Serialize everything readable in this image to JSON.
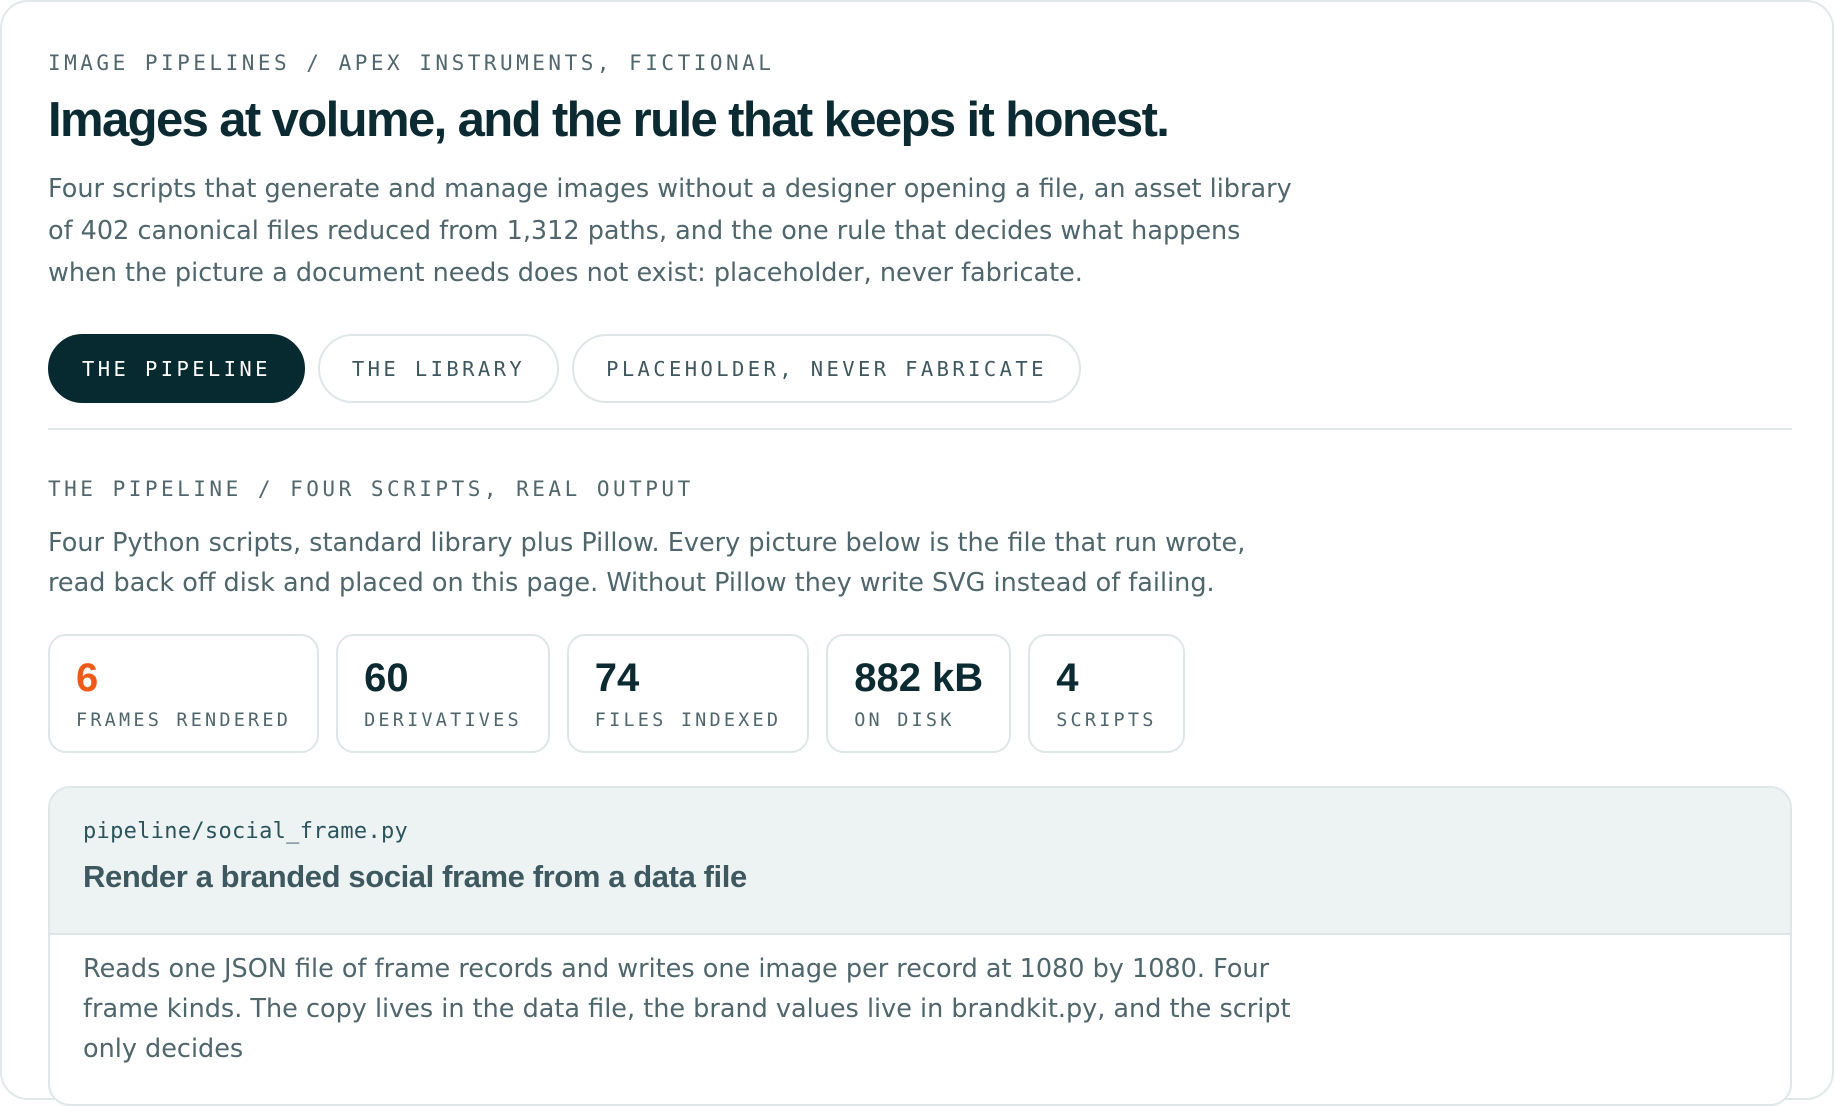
{
  "header": {
    "eyebrow": "IMAGE PIPELINES / APEX INSTRUMENTS, FICTIONAL",
    "title": "Images at volume, and the rule that keeps it honest.",
    "lede": "Four scripts that generate and manage images without a designer opening a file, an asset library of 402 canonical files reduced from 1,312 paths, and the one rule that decides what happens when the picture a document needs does not exist: placeholder, never fabricate."
  },
  "tabs": [
    {
      "label": "THE PIPELINE",
      "active": true
    },
    {
      "label": "THE LIBRARY",
      "active": false
    },
    {
      "label": "PLACEHOLDER, NEVER FABRICATE",
      "active": false
    }
  ],
  "section": {
    "eyebrow": "THE PIPELINE / FOUR SCRIPTS, REAL OUTPUT",
    "description": "Four Python scripts, standard library plus Pillow. Every picture below is the file that run wrote, read back off disk and placed on this page. Without Pillow they write SVG instead of failing."
  },
  "stats": [
    {
      "value": "6",
      "label": "FRAMES RENDERED"
    },
    {
      "value": "60",
      "label": "DERIVATIVES"
    },
    {
      "value": "74",
      "label": "FILES INDEXED"
    },
    {
      "value": "882 kB",
      "label": "ON DISK"
    },
    {
      "value": "4",
      "label": "SCRIPTS"
    }
  ],
  "card": {
    "path": "pipeline/social_frame.py",
    "title": "Render a branded social frame from a data file",
    "body": "Reads one JSON file of frame records and writes one image per record at 1080 by 1080. Four frame kinds. The copy lives in the data file, the brand values live in brandkit.py, and the script only decides"
  },
  "colors": {
    "ink": "#0b2a31",
    "muted": "#4f666d",
    "accent": "#ef5a16",
    "tab_active_bg": "#072a30",
    "border": "#dfe6e8",
    "card_head_bg": "#edf2f3"
  }
}
